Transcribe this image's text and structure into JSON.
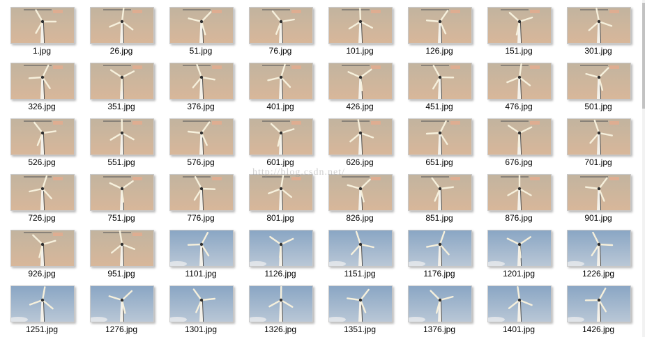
{
  "watermark": "http://blog.csdn.net/",
  "colors": {
    "dusk_sky": "#c2b49f",
    "dusk_ground": "#d8b79a",
    "day_sky": "#8aa6c4",
    "day_ground": "#b9c7d6"
  },
  "files": [
    {
      "name": "1.jpg",
      "kind": "dusk"
    },
    {
      "name": "26.jpg",
      "kind": "dusk"
    },
    {
      "name": "51.jpg",
      "kind": "dusk"
    },
    {
      "name": "76.jpg",
      "kind": "dusk"
    },
    {
      "name": "101.jpg",
      "kind": "dusk"
    },
    {
      "name": "126.jpg",
      "kind": "dusk"
    },
    {
      "name": "151.jpg",
      "kind": "dusk"
    },
    {
      "name": "301.jpg",
      "kind": "dusk"
    },
    {
      "name": "326.jpg",
      "kind": "dusk"
    },
    {
      "name": "351.jpg",
      "kind": "dusk"
    },
    {
      "name": "376.jpg",
      "kind": "dusk"
    },
    {
      "name": "401.jpg",
      "kind": "dusk"
    },
    {
      "name": "426.jpg",
      "kind": "dusk"
    },
    {
      "name": "451.jpg",
      "kind": "dusk"
    },
    {
      "name": "476.jpg",
      "kind": "dusk"
    },
    {
      "name": "501.jpg",
      "kind": "dusk"
    },
    {
      "name": "526.jpg",
      "kind": "dusk"
    },
    {
      "name": "551.jpg",
      "kind": "dusk"
    },
    {
      "name": "576.jpg",
      "kind": "dusk"
    },
    {
      "name": "601.jpg",
      "kind": "dusk"
    },
    {
      "name": "626.jpg",
      "kind": "dusk"
    },
    {
      "name": "651.jpg",
      "kind": "dusk"
    },
    {
      "name": "676.jpg",
      "kind": "dusk"
    },
    {
      "name": "701.jpg",
      "kind": "dusk"
    },
    {
      "name": "726.jpg",
      "kind": "dusk"
    },
    {
      "name": "751.jpg",
      "kind": "dusk"
    },
    {
      "name": "776.jpg",
      "kind": "dusk"
    },
    {
      "name": "801.jpg",
      "kind": "dusk"
    },
    {
      "name": "826.jpg",
      "kind": "dusk"
    },
    {
      "name": "851.jpg",
      "kind": "dusk"
    },
    {
      "name": "876.jpg",
      "kind": "dusk"
    },
    {
      "name": "901.jpg",
      "kind": "dusk"
    },
    {
      "name": "926.jpg",
      "kind": "dusk"
    },
    {
      "name": "951.jpg",
      "kind": "dusk"
    },
    {
      "name": "1101.jpg",
      "kind": "day"
    },
    {
      "name": "1126.jpg",
      "kind": "day"
    },
    {
      "name": "1151.jpg",
      "kind": "day"
    },
    {
      "name": "1176.jpg",
      "kind": "day"
    },
    {
      "name": "1201.jpg",
      "kind": "day"
    },
    {
      "name": "1226.jpg",
      "kind": "day"
    },
    {
      "name": "1251.jpg",
      "kind": "day"
    },
    {
      "name": "1276.jpg",
      "kind": "day"
    },
    {
      "name": "1301.jpg",
      "kind": "day"
    },
    {
      "name": "1326.jpg",
      "kind": "day"
    },
    {
      "name": "1351.jpg",
      "kind": "day"
    },
    {
      "name": "1376.jpg",
      "kind": "day"
    },
    {
      "name": "1401.jpg",
      "kind": "day"
    },
    {
      "name": "1426.jpg",
      "kind": "day"
    }
  ]
}
